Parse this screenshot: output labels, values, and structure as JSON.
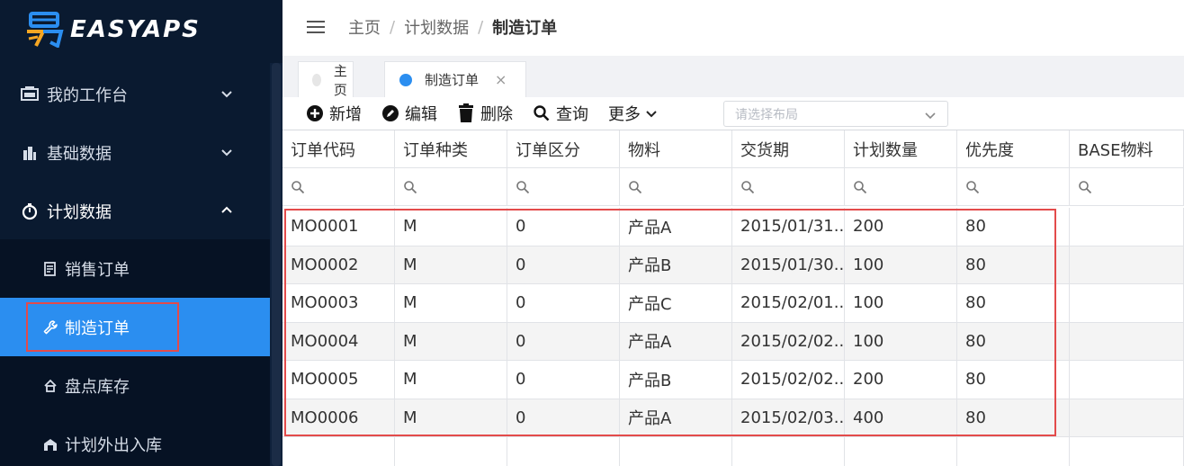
{
  "brand": {
    "name": "EASYAPS",
    "accent": "#2b8ef0",
    "logo_orange": "#f5a623"
  },
  "sidebar": {
    "menu": [
      {
        "label": "我的工作台",
        "icon": "dashboard-icon",
        "expanded": false
      },
      {
        "label": "基础数据",
        "icon": "building-icon",
        "expanded": false
      },
      {
        "label": "计划数据",
        "icon": "stopwatch-icon",
        "expanded": true
      }
    ],
    "submenu": [
      {
        "label": "销售订单",
        "icon": "document-icon",
        "active": false
      },
      {
        "label": "制造订单",
        "icon": "wrench-icon",
        "active": true
      },
      {
        "label": "盘点库存",
        "icon": "home-icon",
        "active": false
      },
      {
        "label": "计划外出入库",
        "icon": "warehouse-icon",
        "active": false
      }
    ]
  },
  "header": {
    "breadcrumb": [
      "主页",
      "计划数据",
      "制造订单"
    ]
  },
  "tabs": [
    {
      "label": "主页",
      "active": false
    },
    {
      "label": "制造订单",
      "active": true,
      "closable": true,
      "close_glyph": "×"
    }
  ],
  "toolbar": {
    "add": "新增",
    "edit": "编辑",
    "delete": "删除",
    "query": "查询",
    "more": "更多",
    "layout_placeholder": "请选择布局"
  },
  "grid": {
    "columns": [
      "订单代码",
      "订单种类",
      "订单区分",
      "物料",
      "交货期",
      "计划数量",
      "优先度",
      "BASE物料"
    ],
    "rows": [
      [
        "MO0001",
        "M",
        "0",
        "产品A",
        "2015/01/31...",
        "200",
        "80",
        ""
      ],
      [
        "MO0002",
        "M",
        "0",
        "产品B",
        "2015/01/30...",
        "100",
        "80",
        ""
      ],
      [
        "MO0003",
        "M",
        "0",
        "产品C",
        "2015/02/01...",
        "100",
        "80",
        ""
      ],
      [
        "MO0004",
        "M",
        "0",
        "产品A",
        "2015/02/02...",
        "100",
        "80",
        ""
      ],
      [
        "MO0005",
        "M",
        "0",
        "产品B",
        "2015/02/02...",
        "200",
        "80",
        ""
      ],
      [
        "MO0006",
        "M",
        "0",
        "产品A",
        "2015/02/03...",
        "400",
        "80",
        ""
      ]
    ]
  }
}
